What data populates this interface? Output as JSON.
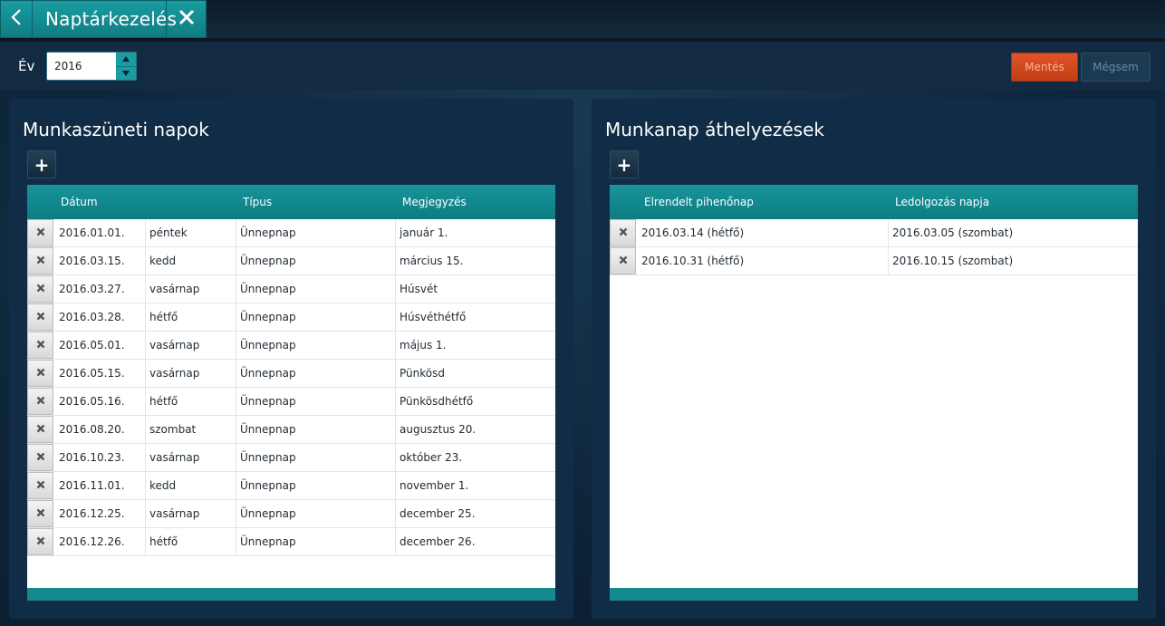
{
  "app": {
    "title": "Naptárkezelés"
  },
  "toolbar": {
    "year_label": "Év",
    "year_value": "2016",
    "save_label": "Mentés",
    "cancel_label": "Mégsem"
  },
  "holidays": {
    "title": "Munkaszüneti napok",
    "add_label": "+",
    "columns": [
      "Dátum",
      "Típus",
      "Megjegyzés"
    ],
    "rows": [
      {
        "date": "2016.01.01.",
        "day": "péntek",
        "type": "Ünnepnap",
        "note": "január 1."
      },
      {
        "date": "2016.03.15.",
        "day": "kedd",
        "type": "Ünnepnap",
        "note": "március 15."
      },
      {
        "date": "2016.03.27.",
        "day": "vasárnap",
        "type": "Ünnepnap",
        "note": "Húsvét"
      },
      {
        "date": "2016.03.28.",
        "day": "hétfő",
        "type": "Ünnepnap",
        "note": "Húsvéthétfő"
      },
      {
        "date": "2016.05.01.",
        "day": "vasárnap",
        "type": "Ünnepnap",
        "note": "május 1."
      },
      {
        "date": "2016.05.15.",
        "day": "vasárnap",
        "type": "Ünnepnap",
        "note": "Pünkösd"
      },
      {
        "date": "2016.05.16.",
        "day": "hétfő",
        "type": "Ünnepnap",
        "note": "Pünkösdhétfő"
      },
      {
        "date": "2016.08.20.",
        "day": "szombat",
        "type": "Ünnepnap",
        "note": "augusztus 20."
      },
      {
        "date": "2016.10.23.",
        "day": "vasárnap",
        "type": "Ünnepnap",
        "note": "október 23."
      },
      {
        "date": "2016.11.01.",
        "day": "kedd",
        "type": "Ünnepnap",
        "note": "november 1."
      },
      {
        "date": "2016.12.25.",
        "day": "vasárnap",
        "type": "Ünnepnap",
        "note": "december 25."
      },
      {
        "date": "2016.12.26.",
        "day": "hétfő",
        "type": "Ünnepnap",
        "note": "december 26."
      }
    ]
  },
  "transfers": {
    "title": "Munkanap áthelyezések",
    "add_label": "+",
    "columns": [
      "Elrendelt pihenőnap",
      "Ledolgozás napja"
    ],
    "rows": [
      {
        "rest_day": "2016.03.14 (hétfő)",
        "work_day": "2016.03.05 (szombat)"
      },
      {
        "rest_day": "2016.10.31 (hétfő)",
        "work_day": "2016.10.15 (szombat)"
      }
    ]
  },
  "icons": {
    "back": "chevron-left-icon",
    "close": "close-icon",
    "delete": "delete-x-icon",
    "add": "plus-icon"
  },
  "colors": {
    "accent_teal": "#1a9ca0",
    "save_orange": "#e1542a",
    "panel_bg": "#102c46"
  }
}
